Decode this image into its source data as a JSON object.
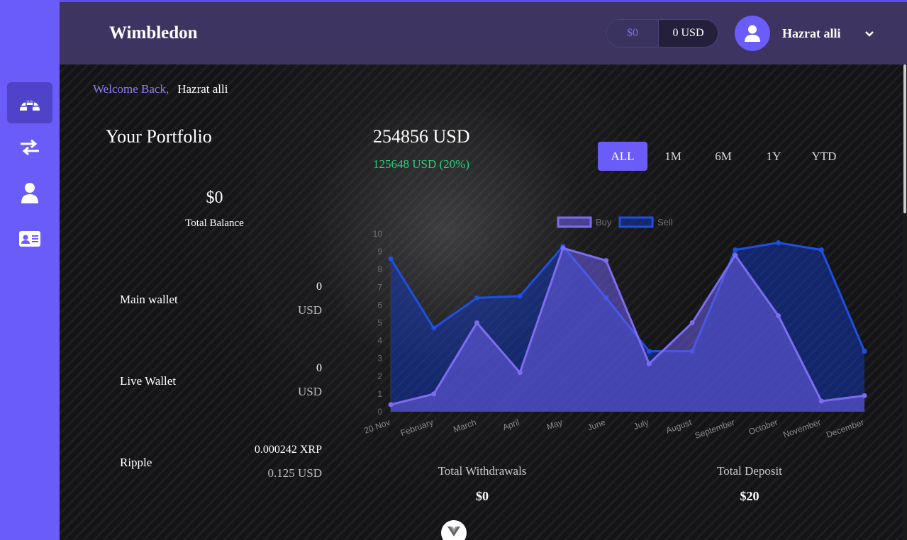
{
  "header": {
    "brand": "Wimbledon",
    "balance_dollar": "$0",
    "balance_usd": "0 USD",
    "username": "Hazrat alli"
  },
  "sidebar": {
    "items": [
      {
        "icon": "igloo-icon",
        "active": true
      },
      {
        "icon": "exchange-arrows-icon",
        "active": false
      },
      {
        "icon": "user-icon",
        "active": false
      },
      {
        "icon": "id-card-icon",
        "active": false
      }
    ]
  },
  "welcome": {
    "greeting": "Welcome Back,",
    "name": "Hazrat alli"
  },
  "portfolio": {
    "title": "Your Portfolio",
    "total_value": "254856 USD",
    "gain": "125648 USD (20%)",
    "balance_amount": "$0",
    "balance_label": "Total Balance"
  },
  "ranges": [
    {
      "label": "ALL",
      "active": true
    },
    {
      "label": "1M",
      "active": false
    },
    {
      "label": "6M",
      "active": false
    },
    {
      "label": "1Y",
      "active": false
    },
    {
      "label": "YTD",
      "active": false
    }
  ],
  "wallets": [
    {
      "name": "Main wallet",
      "amount": "0",
      "unit": "USD"
    },
    {
      "name": "Live Wallet",
      "amount": "0",
      "unit": "USD"
    },
    {
      "name": "Ripple",
      "amount": "0.000242 XRP",
      "unit": "0.125 USD"
    }
  ],
  "stats": {
    "withdrawals_label": "Total Withdrawals",
    "withdrawals_value": "$0",
    "deposit_label": "Total Deposit",
    "deposit_value": "$20"
  },
  "colors": {
    "accent": "#6a5cf8",
    "header": "#3d3462",
    "gain": "#27d17a",
    "buy": "#7b6cf0",
    "sell": "#1f4fe0"
  },
  "chart_data": {
    "type": "area",
    "categories": [
      "20 Nov",
      "February",
      "March",
      "April",
      "May",
      "June",
      "July",
      "August",
      "September",
      "October",
      "November",
      "December"
    ],
    "series": [
      {
        "name": "Buy",
        "values": [
          0.4,
          1.0,
          5.0,
          2.2,
          9.2,
          8.5,
          2.7,
          5.0,
          8.8,
          5.4,
          0.6,
          0.9
        ]
      },
      {
        "name": "Sell",
        "values": [
          8.6,
          4.7,
          6.4,
          6.5,
          9.3,
          6.4,
          3.4,
          3.4,
          9.1,
          9.5,
          9.1,
          3.4
        ]
      }
    ],
    "ylim": [
      0,
      10
    ],
    "yticks": [
      "0",
      "1",
      "2",
      "3",
      "4",
      "5",
      "6",
      "7",
      "8",
      "9",
      "10"
    ],
    "legend": "top"
  }
}
